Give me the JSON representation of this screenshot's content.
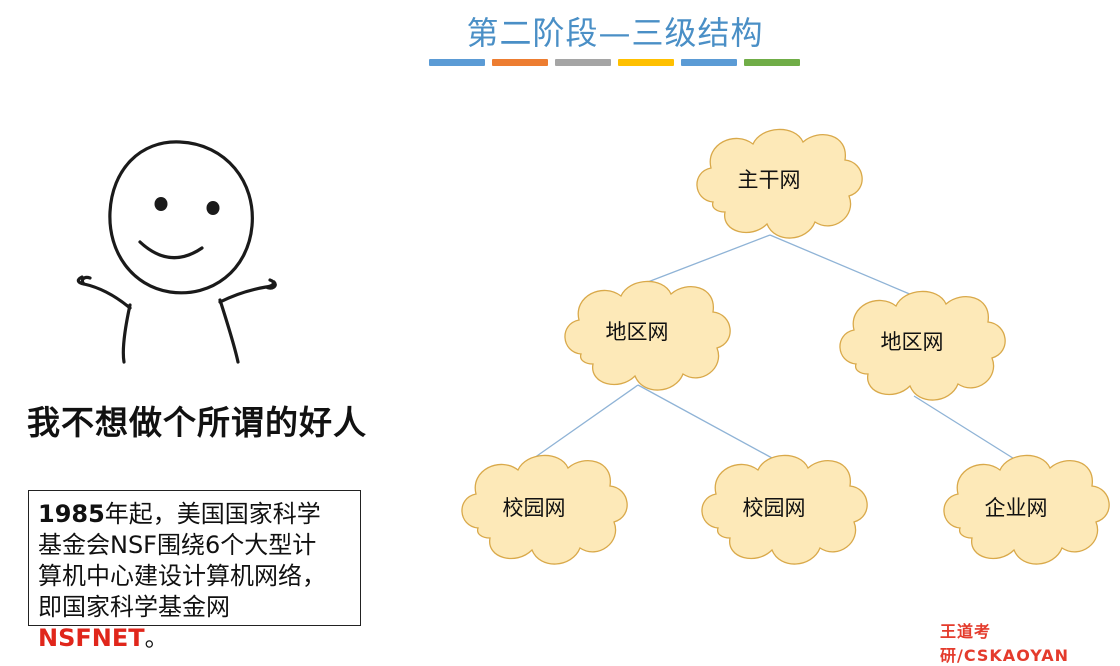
{
  "title": "第二阶段—三级结构",
  "title_bar_colors": [
    "#5b9bd5",
    "#ed7d31",
    "#a5a5a5",
    "#ffc000",
    "#5b9bd5",
    "#70ad47"
  ],
  "meme_caption": "我不想做个所谓的好人",
  "info": {
    "year": "1985",
    "line1_rest": "年起，美国国家科学",
    "line2": "基金会NSF围绕6个大型计",
    "line3": "算机中心建设计算机网络，",
    "line4_pre": "即国家科学基金网",
    "line4_highlight": "NSFNET",
    "line4_post": "。"
  },
  "tree": {
    "root": "主干网",
    "regional_a": "地区网",
    "regional_b": "地区网",
    "campus_a": "校园网",
    "campus_b": "校园网",
    "enterprise": "企业网"
  },
  "colors": {
    "cloud_fill": "#fde9b8",
    "cloud_stroke": "#d9a94a",
    "edge": "#8fb3d6",
    "accent_red": "#e0261b"
  },
  "watermark_text": "王道考研/CSKAOYAN"
}
